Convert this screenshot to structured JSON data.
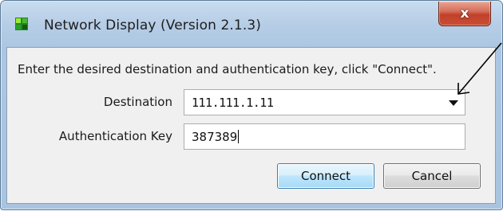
{
  "window": {
    "title": "Network Display (Version 2.1.3)",
    "close_label": "x"
  },
  "dialog": {
    "instruction": "Enter the desired destination and authentication key, click \"Connect\".",
    "destination": {
      "label": "Destination",
      "value": "111.111.1.11"
    },
    "auth_key": {
      "label": "Authentication Key",
      "value": "387389"
    },
    "buttons": {
      "connect": "Connect",
      "cancel": "Cancel"
    }
  },
  "icons": {
    "app": "network-display-app-icon",
    "close": "close-icon",
    "dropdown": "chevron-down-icon",
    "annotation": "annotation-arrow-icon"
  },
  "colors": {
    "frame": "#abc6e2",
    "close_button": "#c84f35",
    "default_button_border": "#3c7fb1"
  }
}
